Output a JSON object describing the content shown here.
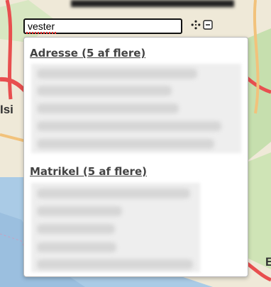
{
  "search": {
    "value": "vester"
  },
  "map": {
    "labels": {
      "left": "Isi",
      "right": "E"
    }
  },
  "results": {
    "adresse_title": "Adresse (5 af flere)",
    "matrikel_title": "Matrikel (5 af flere)",
    "adresse_count": 5,
    "matrikel_count": 5
  },
  "icons": {
    "move": "move-icon",
    "collapse": "collapse-icon"
  },
  "colors": {
    "map_base": "#efe9d8",
    "water": "#aacbe6",
    "green": "#c6dfae",
    "road_major": "#e84f4f",
    "road_secondary": "#f2c27b",
    "section_title": "#444444",
    "search_border": "#111111"
  }
}
